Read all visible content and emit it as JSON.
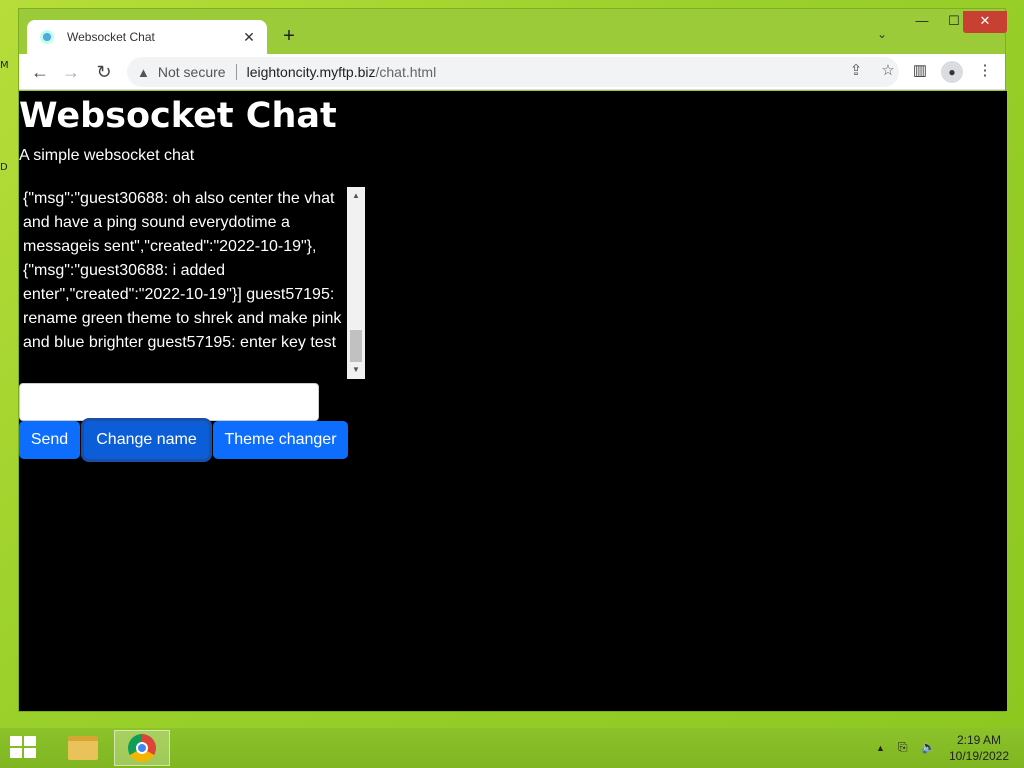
{
  "desktop": {
    "glyph_1": "M",
    "glyph_2": "D"
  },
  "browser": {
    "tab_title": "Websocket Chat",
    "tab_close": "✕",
    "new_tab": "+",
    "tab_list": "⌄",
    "window_controls": {
      "minimize": "—",
      "maximize": "☐",
      "close": "✕"
    },
    "nav": {
      "back": "←",
      "forward": "→",
      "reload": "↻"
    },
    "security_label": "Not secure",
    "url_host": "leightoncity.myftp.biz",
    "url_path": "/chat.html"
  },
  "page": {
    "title": "Websocket Chat",
    "subtitle": "A simple websocket chat",
    "chat_log": "{\"msg\":\"guest30688: oh also center the vhat and have a ping sound everydotime a messageis sent\",\"created\":\"2022-10-19\"},{\"msg\":\"guest30688: i added enter\",\"created\":\"2022-10-19\"}] guest57195: rename green theme to shrek and make pink and blue brighter guest57195: enter key test",
    "message_input_value": "",
    "buttons": {
      "send": "Send",
      "change_name": "Change name",
      "theme_changer": "Theme changer"
    }
  },
  "taskbar": {
    "time": "2:19 AM",
    "date": "10/19/2022"
  },
  "colors": {
    "button_primary": "#0d6efd",
    "page_background": "#000000",
    "desktop_green": "#9bd02a",
    "close_red": "#c84032"
  }
}
